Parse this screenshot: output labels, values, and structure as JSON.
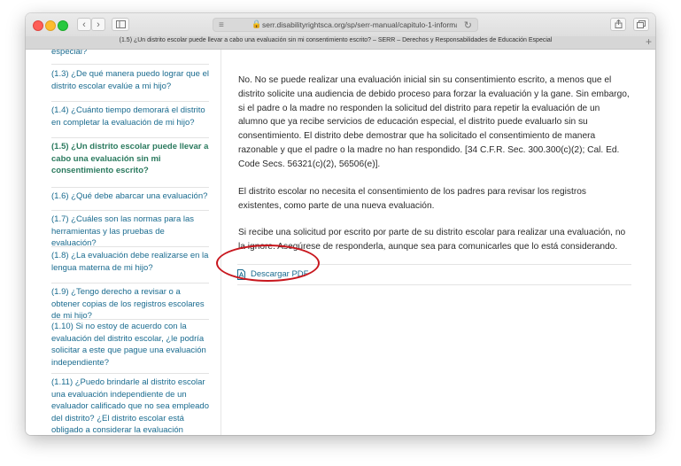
{
  "browser": {
    "url": "serr.disabilityrightsca.org/sp/serr-manual/capitulo-1-informacion-so",
    "tab_title": "(1.5) ¿Un distrito escolar puede llevar a cabo una evaluación sin mi consentimiento escrito? – SERR – Derechos y Responsabilidades de Educación Especial",
    "back_icon": "‹",
    "forward_icon": "›",
    "new_tab_icon": "+"
  },
  "sidebar": {
    "cut_top": "especial?",
    "items": [
      {
        "label": "(1.3) ¿De qué manera puedo lograr que el distrito escolar evalúe a mi hijo?"
      },
      {
        "label": "(1.4) ¿Cuánto tiempo demorará el distrito en completar la evaluación de mi hijo?"
      },
      {
        "label": "(1.5) ¿Un distrito escolar puede llevar a cabo una evaluación sin mi consentimiento escrito?"
      },
      {
        "label": "(1.6) ¿Qué debe abarcar una evaluación?"
      },
      {
        "label": "(1.7) ¿Cuáles son las normas para las herramientas y las pruebas de evaluación?"
      },
      {
        "label": "(1.8) ¿La evaluación debe realizarse en la lengua materna de mi hijo?"
      },
      {
        "label": "(1.9) ¿Tengo derecho a revisar o a obtener copias de los registros escolares de mi hijo?"
      },
      {
        "label": "(1.10) Si no estoy de acuerdo con la evaluación del distrito escolar, ¿le podría solicitar a este que pague una evaluación independiente?"
      },
      {
        "label": "(1.11) ¿Puedo brindarle al distrito escolar una evaluación independiente de un evaluador calificado que no sea empleado del distrito? ¿El distrito escolar está obligado a considerar la evaluación independiente?"
      }
    ]
  },
  "content": {
    "paragraphs": [
      "No. No se puede realizar una evaluación inicial sin su consentimiento escrito, a menos que el distrito solicite una audiencia de debido proceso para forzar la evaluación y la gane. Sin embargo, si el padre o la madre no responden la solicitud del distrito para repetir la evaluación de un alumno que ya recibe servicios de educación especial, el distrito puede evaluarlo sin su consentimiento. El distrito debe demostrar que ha solicitado el consentimiento de manera razonable y que el padre o la madre no han respondido. [34 C.F.R. Sec. 300.300(c)(2); Cal. Ed. Code Secs. 56321(c)(2), 56506(e)].",
      "El distrito escolar no necesita el consentimiento de los padres para revisar los registros existentes, como parte de una nueva evaluación.",
      "Si recibe una solicitud por escrito por parte de su distrito escolar para realizar una evaluación, no la ignore. Asegúrese de responderla, aunque sea para comunicarles que lo está considerando."
    ],
    "download_pdf": "Descargar PDF"
  },
  "colors": {
    "link": "#1a6b8f",
    "active_link": "#2b7a5e",
    "highlight_circle": "#c8171e"
  }
}
